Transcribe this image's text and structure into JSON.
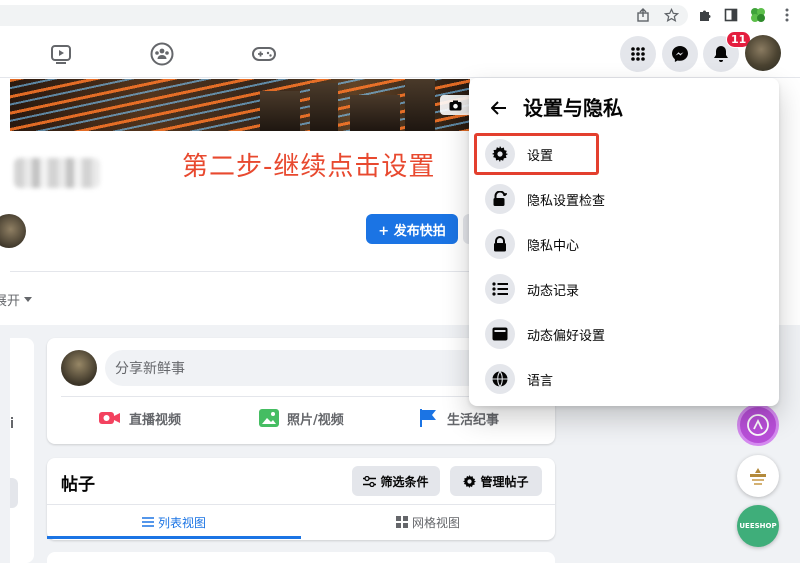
{
  "annotation": {
    "step_text": "第二步-继续点击设置"
  },
  "browser": {
    "icons": [
      "share-icon",
      "star-icon",
      "extension-puzzle-icon",
      "side-panel-icon",
      "clover-extension-icon",
      "kebab-menu-icon"
    ]
  },
  "fb_nav": {
    "tabs": [
      "watch-icon",
      "groups-icon",
      "gaming-icon"
    ],
    "notification_count": "11"
  },
  "profile": {
    "publish_button": "+ 发布快拍",
    "more_tab": "展开"
  },
  "settings_menu": {
    "title": "设置与隐私",
    "items": [
      {
        "label": "设置",
        "icon": "gear-icon"
      },
      {
        "label": "隐私设置检查",
        "icon": "lock-heart-icon"
      },
      {
        "label": "隐私中心",
        "icon": "lock-icon"
      },
      {
        "label": "动态记录",
        "icon": "list-icon"
      },
      {
        "label": "动态偏好设置",
        "icon": "feed-preferences-icon"
      },
      {
        "label": "语言",
        "icon": "globe-icon"
      }
    ]
  },
  "composer": {
    "placeholder": "分享新鲜事",
    "actions": [
      {
        "label": "直播视频",
        "color": "#f3425f"
      },
      {
        "label": "照片/视频",
        "color": "#45bd62"
      },
      {
        "label": "生活纪事",
        "color": "#1b74e4"
      }
    ]
  },
  "posts": {
    "title": "帖子",
    "filter_button": "筛选条件",
    "manage_button": "管理帖子",
    "list_view": "列表视图",
    "grid_view": "网格视图"
  },
  "floating": {
    "shop_label": "UEESHOP"
  },
  "colors": {
    "accent": "#1b74e4",
    "annotation_red": "#e33f2e",
    "badge_red": "#e41e3f"
  }
}
